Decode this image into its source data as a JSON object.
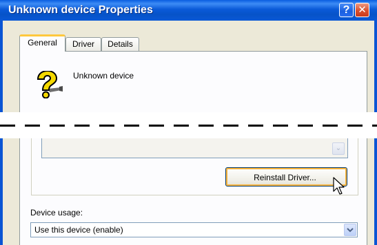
{
  "window": {
    "title": "Unknown device Properties",
    "help_glyph": "?",
    "close_glyph": "✕",
    "help_icon": "help-icon",
    "close_icon": "close-icon"
  },
  "tabs": [
    {
      "label": "General",
      "active": true
    },
    {
      "label": "Driver",
      "active": false
    },
    {
      "label": "Details",
      "active": false
    }
  ],
  "general": {
    "device_name": "Unknown device",
    "device_icon": "question-mark-device-icon",
    "status_scroll_glyph": "⌄",
    "reinstall_button_label": "Reinstall Driver...",
    "device_usage_label": "Device usage:",
    "device_usage_value": "Use this device (enable)",
    "dropdown_icon": "chevron-down-icon"
  },
  "colors": {
    "titlebar": "#0a55d4",
    "active_tab_accent": "#ffc83c",
    "button_focus": "#f8b33c",
    "dialog_bg": "#ece9d8"
  }
}
